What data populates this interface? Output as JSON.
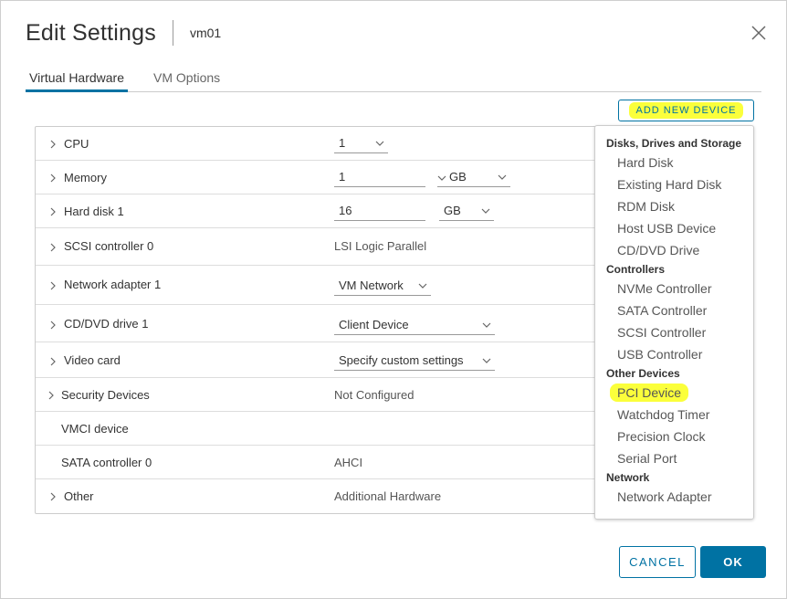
{
  "dialog": {
    "title": "Edit Settings",
    "vm_name": "vm01"
  },
  "tabs": [
    {
      "label": "Virtual Hardware",
      "active": true
    },
    {
      "label": "VM Options",
      "active": false
    }
  ],
  "add_device_label": "ADD NEW DEVICE",
  "hardware": {
    "cpu": {
      "label": "CPU",
      "value": "1"
    },
    "memory": {
      "label": "Memory",
      "value": "1",
      "unit": "GB"
    },
    "hard_disk": {
      "label": "Hard disk 1",
      "value": "16",
      "unit": "GB"
    },
    "scsi": {
      "label": "SCSI controller 0",
      "value": "LSI Logic Parallel"
    },
    "network": {
      "label": "Network adapter 1",
      "value": "VM Network"
    },
    "cddvd": {
      "label": "CD/DVD drive 1",
      "value": "Client Device"
    },
    "video": {
      "label": "Video card",
      "value": "Specify custom settings"
    },
    "security": {
      "label": "Security Devices",
      "value": "Not Configured"
    },
    "vmci": {
      "label": "VMCI device"
    },
    "sata": {
      "label": "SATA controller 0",
      "value": "AHCI"
    },
    "other": {
      "label": "Other",
      "value": "Additional Hardware"
    }
  },
  "dropdown": {
    "groups": [
      {
        "header": "Disks, Drives and Storage",
        "items": [
          "Hard Disk",
          "Existing Hard Disk",
          "RDM Disk",
          "Host USB Device",
          "CD/DVD Drive"
        ]
      },
      {
        "header": "Controllers",
        "items": [
          "NVMe Controller",
          "SATA Controller",
          "SCSI Controller",
          "USB Controller"
        ]
      },
      {
        "header": "Other Devices",
        "items": [
          "PCI Device",
          "Watchdog Timer",
          "Precision Clock",
          "Serial Port"
        ]
      },
      {
        "header": "Network",
        "items": [
          "Network Adapter"
        ]
      }
    ],
    "highlighted_item": "PCI Device"
  },
  "footer": {
    "cancel_label": "CANCEL",
    "ok_label": "OK"
  },
  "colors": {
    "accent": "#0072a3",
    "highlight": "#fbff3b"
  }
}
